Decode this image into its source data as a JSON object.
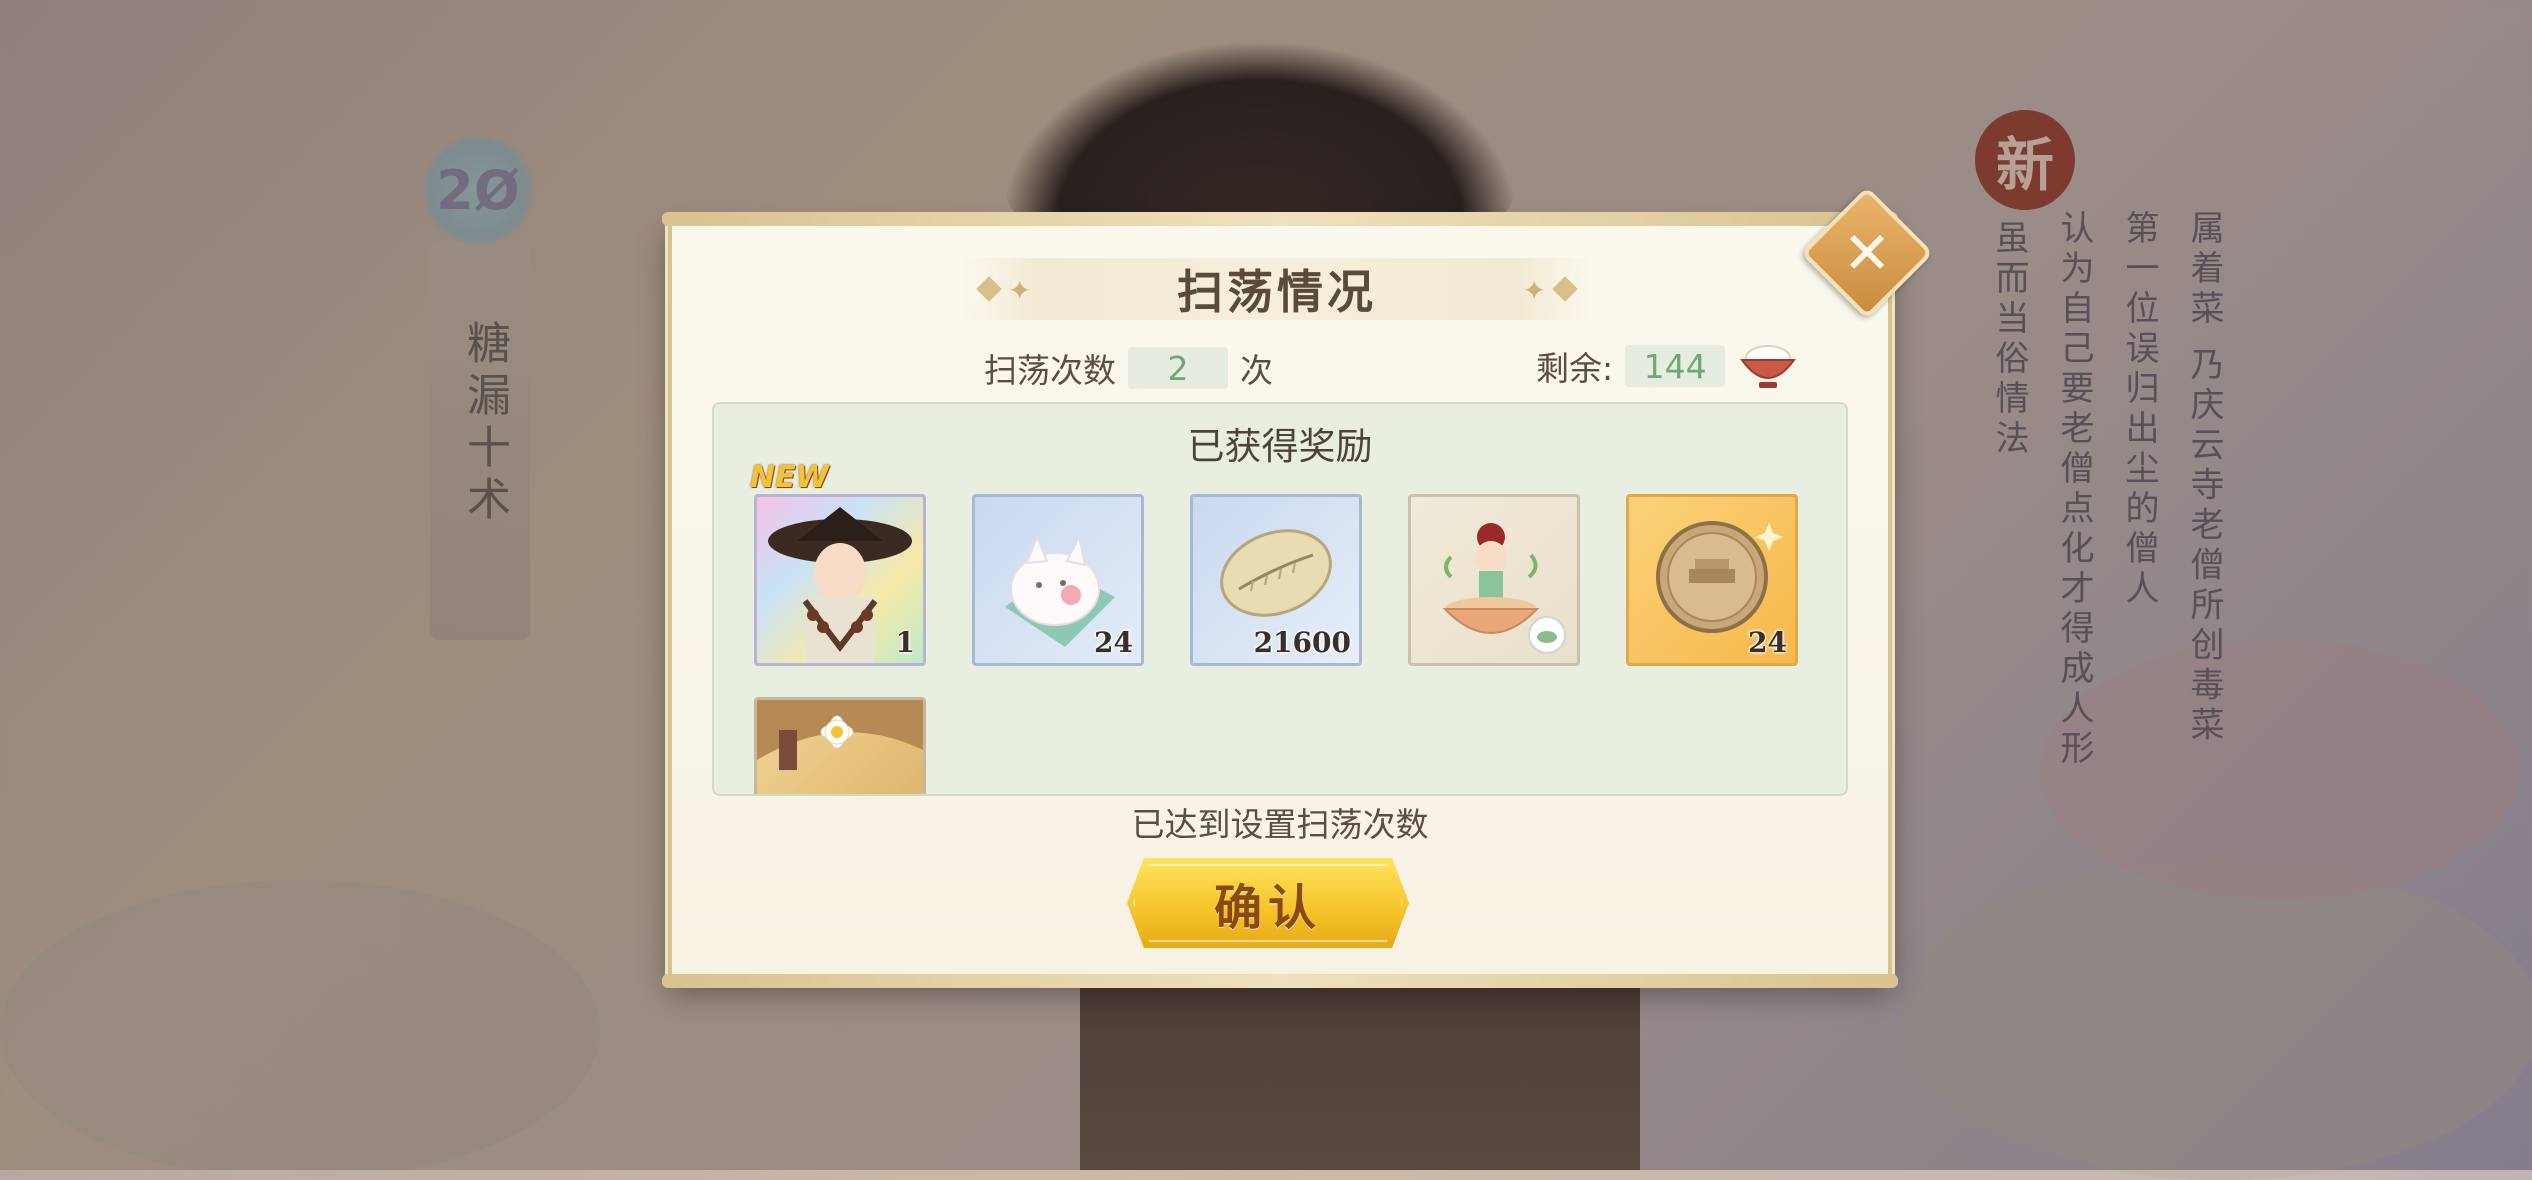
{
  "background": {
    "left_badge": "2Ø",
    "left_vertical": "糖漏十术",
    "right_stamp": "新",
    "right_columns": [
      "属着菜 乃庆云寺老僧所创毒菜",
      "第一位误归出尘的僧人",
      "认为自己要老僧点化才得成人形",
      "虽而当俗情法"
    ]
  },
  "dialog": {
    "title": "扫荡情况",
    "close_icon": "✕",
    "sweep_count_label": "扫荡次数",
    "sweep_count_value": "2",
    "sweep_count_unit": "次",
    "remaining_label": "剩余:",
    "remaining_value": "144",
    "rewards_title": "已获得奖励",
    "new_badge": "NEW",
    "items": [
      {
        "name": "character-card",
        "count": "1"
      },
      {
        "name": "bun-ingredient",
        "count": "24"
      },
      {
        "name": "shell-currency",
        "count": "21600"
      },
      {
        "name": "teacup-spirit",
        "count": ""
      },
      {
        "name": "coin-medal",
        "count": "24"
      },
      {
        "name": "partial-character-card",
        "count": ""
      }
    ],
    "status_text": "已达到设置扫荡次数",
    "confirm_label": "确认"
  }
}
